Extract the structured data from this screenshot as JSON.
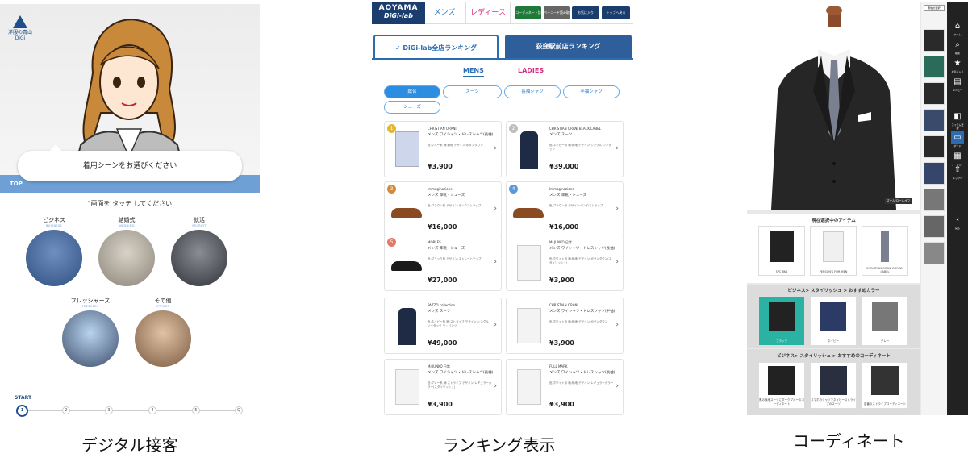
{
  "panel1": {
    "logo_text": "洋服の青山",
    "logo_sub": "DiGi",
    "bubble": "着用シーンをお選びください",
    "top_label": "TOP",
    "prompt": "\"画面を タッチ してください",
    "scenes": [
      {
        "label": "ビジネス",
        "sub": "BUSINESS",
        "color": "#3e5f93"
      },
      {
        "label": "結婚式",
        "sub": "WEDDING",
        "color": "#a09a8e"
      },
      {
        "label": "就活",
        "sub": "RECRUIT",
        "color": "#55585f"
      },
      {
        "label": "フレッシャーズ",
        "sub": "FRESHERS",
        "color": "#7a9ec9"
      },
      {
        "label": "その他",
        "sub": "OTHERS",
        "color": "#b78a6a"
      }
    ],
    "start_label": "START",
    "steps": [
      "1",
      "2",
      "3",
      "4",
      "5",
      "Q"
    ]
  },
  "panel2": {
    "brand_top": "AOYAMA",
    "brand_bottom": "DiGi-lab",
    "nav_mens": "メンズ",
    "nav_ladies": "レディース",
    "nav_buttons": [
      "コーディネート診断",
      "バーコード読み取り",
      "お気に入り",
      "トップへ戻る"
    ],
    "tab_all": "✓ DiGi-lab全店ランキング",
    "tab_store": "荻窪駅前店ランキング",
    "gender_mens": "MENS",
    "gender_ladies": "LADIES",
    "chips": [
      "総合",
      "スーツ",
      "長袖シャツ",
      "半袖シャツ",
      "シューズ"
    ],
    "products": [
      {
        "rank": "1",
        "brand": "CHRISTIAN ORANI",
        "name": "メンズ ワイシャツ・ドレスシャツ(長袖)",
        "spec": "色:ブルー系 柄:無地 デザイン:ボタンダウン",
        "price": "¥3,900",
        "kind": "shirt-blue"
      },
      {
        "rank": "2",
        "brand": "CHRISTIAN ORANI BLACK LABEL",
        "name": "メンズ スーツ",
        "spec": "色:ネイビー系 柄:無地 デザイン:シングル ワンタック",
        "price": "¥39,000",
        "kind": "suit"
      },
      {
        "rank": "3",
        "brand": "Immaginazione",
        "name": "メンズ 革靴・シューズ",
        "spec": "色:ブラウン系 デザイン:モンクストラップ",
        "price": "¥16,000",
        "kind": "shoe"
      },
      {
        "rank": "4",
        "brand": "Immaginazione",
        "name": "メンズ 革靴・シューズ",
        "spec": "色:ブラウン系 デザイン:モンクストラップ",
        "price": "¥16,000",
        "kind": "shoe"
      },
      {
        "rank": "5",
        "brand": "MORLES",
        "name": "メンズ 革靴・シューズ",
        "spec": "色:ブラック系 デザイン:ストレートチップ",
        "price": "¥27,000",
        "kind": "shoe-black"
      },
      {
        "rank": "",
        "brand": "Mr.JUNKO 日常",
        "name": "メンズ ワイシャツ・ドレスシャツ(長袖)",
        "spec": "色:ホワイト系 柄:無地 デザイン:ボタンダウン(スタイリッシュ)",
        "price": "¥3,900",
        "kind": "shirt-white"
      },
      {
        "rank": "",
        "brand": "PAZZO collection",
        "name": "メンズ スーツ",
        "spec": "色:ネイビー系 柄:ストライプ デザイン:シングル ノータック ウ・パンツ",
        "price": "¥49,000",
        "kind": "suit"
      },
      {
        "rank": "",
        "brand": "CHRISTIAN ORANI",
        "name": "メンズ ワイシャツ・ドレスシャツ(半袖)",
        "spec": "色:ホワイト系 柄:無地 デザイン:ボタンダウン",
        "price": "¥3,900",
        "kind": "shirt-white"
      },
      {
        "rank": "",
        "brand": "Mr.JUNKO 日常",
        "name": "メンズ ワイシャツ・ドレスシャツ(長袖)",
        "spec": "色:グレー系 柄:ストライプ デザイン:レギュラーカラー(スタイリッシュ)",
        "price": "¥3,900",
        "kind": "shirt-white"
      },
      {
        "rank": "",
        "brand": "FULL MARK",
        "name": "メンズ ワイシャツ・ドレスシャツ(長袖)",
        "spec": "色:ホワイト系 柄:無地 デザイン:レギュラーカラー",
        "price": "¥3,900",
        "kind": "shirt-white"
      }
    ]
  },
  "panel3": {
    "top_button": "現在の選択",
    "zoom_badge": "ズーム/ロールオフ",
    "current_items_title": "現在選択中のアイテム",
    "current_items": [
      "SPC BK1",
      "PERSON'S FOR MEN",
      "CHRISTIAN ORANI BROWN LABEL"
    ],
    "color_title": "ビジネス> スタイリッシュ > おすすめカラー",
    "colors": [
      "ブラック",
      "ネイビー",
      "グレー"
    ],
    "coord_title": "ビジネス> スタイリッシュ > おすすめのコーディネート",
    "coords": [
      "黒の無地スーツにダークブルーのコーディネート",
      "スマホのシャツでネイビーストライプのスーツ",
      "定番のストライプコーディネート"
    ],
    "side_icons": [
      {
        "icon": "⌂",
        "label": "ホーム"
      },
      {
        "icon": "⌕",
        "label": "検索"
      },
      {
        "icon": "★",
        "label": "お気に入り"
      },
      {
        "icon": "▤",
        "label": "メニュー"
      },
      {
        "icon": "◧",
        "label": "アイテム選択"
      },
      {
        "icon": "▭",
        "label": "ボード"
      },
      {
        "icon": "▦",
        "label": "ワードローブ"
      },
      {
        "icon": "⇧",
        "label": "トップへ"
      },
      {
        "icon": "‹",
        "label": "戻る"
      }
    ]
  },
  "captions": [
    "デジタル接客",
    "ランキング表示",
    "コーディネート"
  ]
}
